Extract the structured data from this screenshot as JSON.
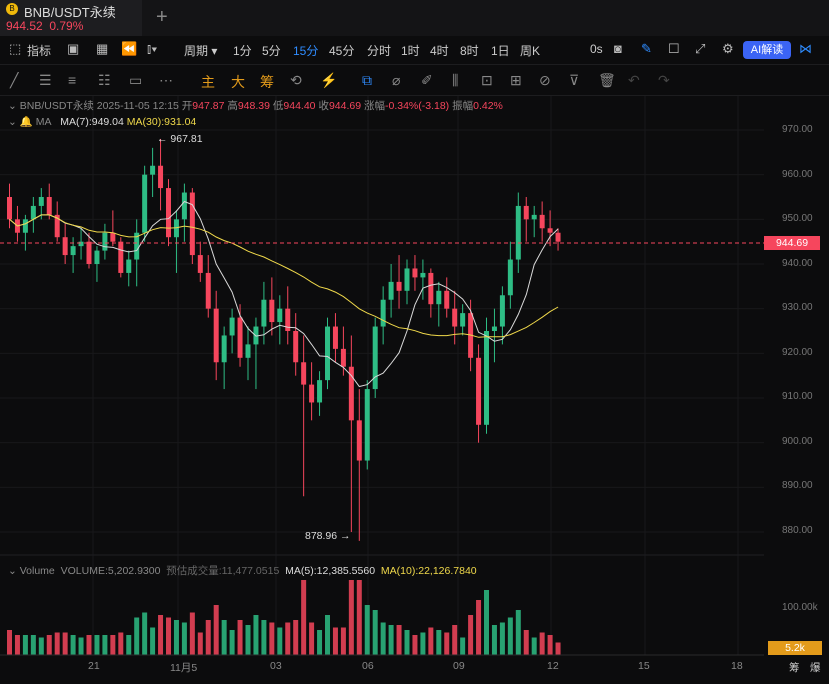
{
  "tab": {
    "symbol": "BNB/USDT永续",
    "price": "944.52",
    "change": "0.79%"
  },
  "toolbar": {
    "indicators": "指标",
    "period": "周期",
    "intervals": [
      "1分",
      "5分",
      "15分",
      "45分",
      "分时",
      "1时",
      "4时",
      "8时",
      "1日",
      "周K"
    ],
    "selected_interval": "15分",
    "countdown": "0s",
    "ai_label": "AI解读"
  },
  "drawing_tools": {
    "main": "主",
    "big": "大",
    "chips": "筹"
  },
  "ohlc": {
    "symbol": "BNB/USDT永续",
    "datetime": "2025-11-05 12:15",
    "open_label": "开",
    "open": "947.87",
    "high_label": "高",
    "high": "948.39",
    "low_label": "低",
    "low": "944.40",
    "close_label": "收",
    "close": "944.69",
    "change_label": "涨幅",
    "change": "-0.34%(-3.18)",
    "amp_label": "振幅",
    "amp": "0.42%"
  },
  "ma": {
    "label": "MA",
    "ma7": "MA(7):949.04",
    "ma30": "MA(30):931.04"
  },
  "annotations": {
    "high": "967.81",
    "low": "878.96"
  },
  "last_price": "944.69",
  "volume": {
    "title": "Volume",
    "volume": "VOLUME:5,202.9300",
    "est_label": "预估成交量:11,477.0515",
    "ma5": "MA(5):12,385.5560",
    "ma10": "MA(10):22,126.7840",
    "axis_label": "100.00k",
    "last_box": "5.2k"
  },
  "price_axis": [
    "970.00",
    "960.00",
    "950.00",
    "940.00",
    "930.00",
    "920.00",
    "910.00",
    "900.00",
    "890.00",
    "880.00"
  ],
  "time_axis": [
    "21",
    "11月5",
    "03",
    "06",
    "09",
    "12",
    "15",
    "18"
  ],
  "bottom_right": [
    "筹",
    "爆"
  ],
  "colors": {
    "up": "#2ebd85",
    "down": "#f6465d",
    "ma7": "#d9d9d9",
    "ma30": "#f0d94b",
    "accent": "#2f8cff"
  },
  "chart_data": {
    "type": "candlestick",
    "ylim": [
      875,
      975
    ],
    "series": [
      {
        "name": "candles",
        "values": [
          [
            955,
            958,
            948,
            950
          ],
          [
            950,
            953,
            945,
            947
          ],
          [
            947,
            951,
            943,
            950
          ],
          [
            950,
            955,
            947,
            953
          ],
          [
            953,
            957,
            950,
            955
          ],
          [
            955,
            958,
            950,
            951
          ],
          [
            951,
            954,
            945,
            946
          ],
          [
            946,
            949,
            940,
            942
          ],
          [
            942,
            946,
            938,
            944
          ],
          [
            944,
            948,
            941,
            945
          ],
          [
            945,
            947,
            939,
            940
          ],
          [
            940,
            944,
            936,
            943
          ],
          [
            943,
            949,
            941,
            947
          ],
          [
            947,
            952,
            944,
            945
          ],
          [
            945,
            946,
            937,
            938
          ],
          [
            938,
            943,
            935,
            941
          ],
          [
            941,
            950,
            935,
            947
          ],
          [
            947,
            962,
            945,
            960
          ],
          [
            960,
            966,
            955,
            962
          ],
          [
            962,
            968,
            952,
            957
          ],
          [
            957,
            959,
            944,
            946
          ],
          [
            946,
            952,
            938,
            950
          ],
          [
            950,
            958,
            945,
            956
          ],
          [
            956,
            957,
            940,
            942
          ],
          [
            942,
            945,
            936,
            938
          ],
          [
            938,
            942,
            928,
            930
          ],
          [
            930,
            934,
            914,
            918
          ],
          [
            918,
            926,
            912,
            924
          ],
          [
            924,
            930,
            920,
            928
          ],
          [
            928,
            931,
            917,
            919
          ],
          [
            919,
            926,
            914,
            922
          ],
          [
            922,
            928,
            912,
            926
          ],
          [
            926,
            936,
            922,
            932
          ],
          [
            932,
            937,
            924,
            927
          ],
          [
            927,
            933,
            922,
            930
          ],
          [
            930,
            935,
            922,
            925
          ],
          [
            925,
            929,
            915,
            918
          ],
          [
            918,
            924,
            888,
            913
          ],
          [
            913,
            918,
            905,
            909
          ],
          [
            909,
            916,
            906,
            914
          ],
          [
            914,
            928,
            912,
            926
          ],
          [
            926,
            929,
            918,
            921
          ],
          [
            921,
            926,
            915,
            917
          ],
          [
            917,
            924,
            880,
            905
          ],
          [
            905,
            912,
            878,
            896
          ],
          [
            896,
            914,
            894,
            912
          ],
          [
            912,
            928,
            910,
            926
          ],
          [
            926,
            935,
            922,
            932
          ],
          [
            932,
            940,
            928,
            936
          ],
          [
            936,
            942,
            930,
            934
          ],
          [
            934,
            941,
            931,
            939
          ],
          [
            939,
            942,
            934,
            937
          ],
          [
            937,
            941,
            932,
            938
          ],
          [
            938,
            939,
            928,
            931
          ],
          [
            931,
            936,
            926,
            934
          ],
          [
            934,
            937,
            928,
            930
          ],
          [
            930,
            934,
            922,
            926
          ],
          [
            926,
            931,
            924,
            929
          ],
          [
            929,
            932,
            916,
            919
          ],
          [
            919,
            922,
            900,
            904
          ],
          [
            904,
            928,
            902,
            925
          ],
          [
            925,
            930,
            918,
            926
          ],
          [
            926,
            935,
            922,
            933
          ],
          [
            933,
            945,
            930,
            941
          ],
          [
            941,
            956,
            938,
            953
          ],
          [
            953,
            955,
            945,
            950
          ],
          [
            950,
            953,
            946,
            951
          ],
          [
            951,
            954,
            945,
            948
          ],
          [
            948,
            952,
            944,
            947
          ],
          [
            947,
            948,
            943,
            945
          ]
        ]
      },
      {
        "name": "MA(7)",
        "values": []
      },
      {
        "name": "MA(30)",
        "values": []
      }
    ]
  }
}
